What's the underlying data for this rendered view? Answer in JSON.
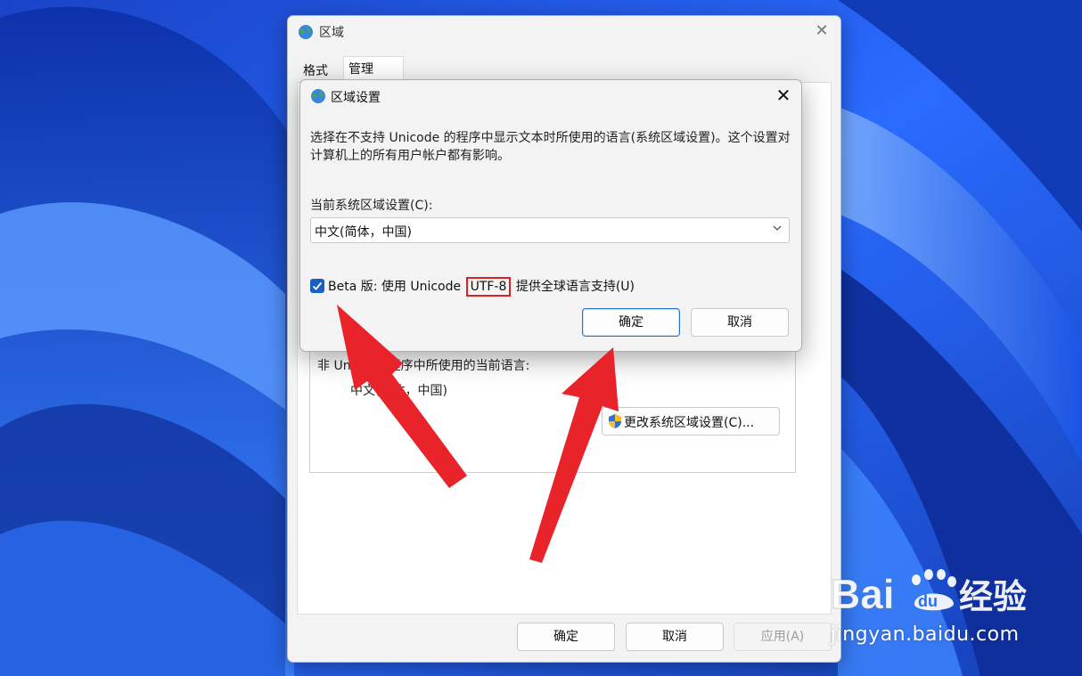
{
  "outer_window": {
    "title": "区域",
    "tabs": [
      {
        "label": "格式"
      },
      {
        "label": "管理"
      }
    ],
    "group": {
      "label": "非 Unicode 程序中所使用的当前语言:",
      "value": "中文(简体，中国)",
      "change_button": "更改系统区域设置(C)..."
    },
    "buttons": {
      "ok": "确定",
      "cancel": "取消",
      "apply": "应用(A)"
    }
  },
  "dialog": {
    "title": "区域设置",
    "description": "选择在不支持 Unicode 的程序中显示文本时所使用的语言(系统区域设置)。这个设置对计算机上的所有用户帐户都有影响。",
    "current_label": "当前系统区域设置(C):",
    "current_value": "中文(简体，中国)",
    "beta_checkbox": {
      "checked": true,
      "label_before": "Beta 版: 使用 Unicode ",
      "label_highlight": "UTF-8",
      "label_after": " 提供全球语言支持(U)"
    },
    "ok_label": "确定",
    "cancel_label": "取消"
  },
  "watermark": {
    "logo_text": "Bai du 经验",
    "url": "jingyan.baidu.com"
  },
  "annotation": {
    "highlight_color": "#e02020",
    "arrow_color": "#e8232a"
  }
}
